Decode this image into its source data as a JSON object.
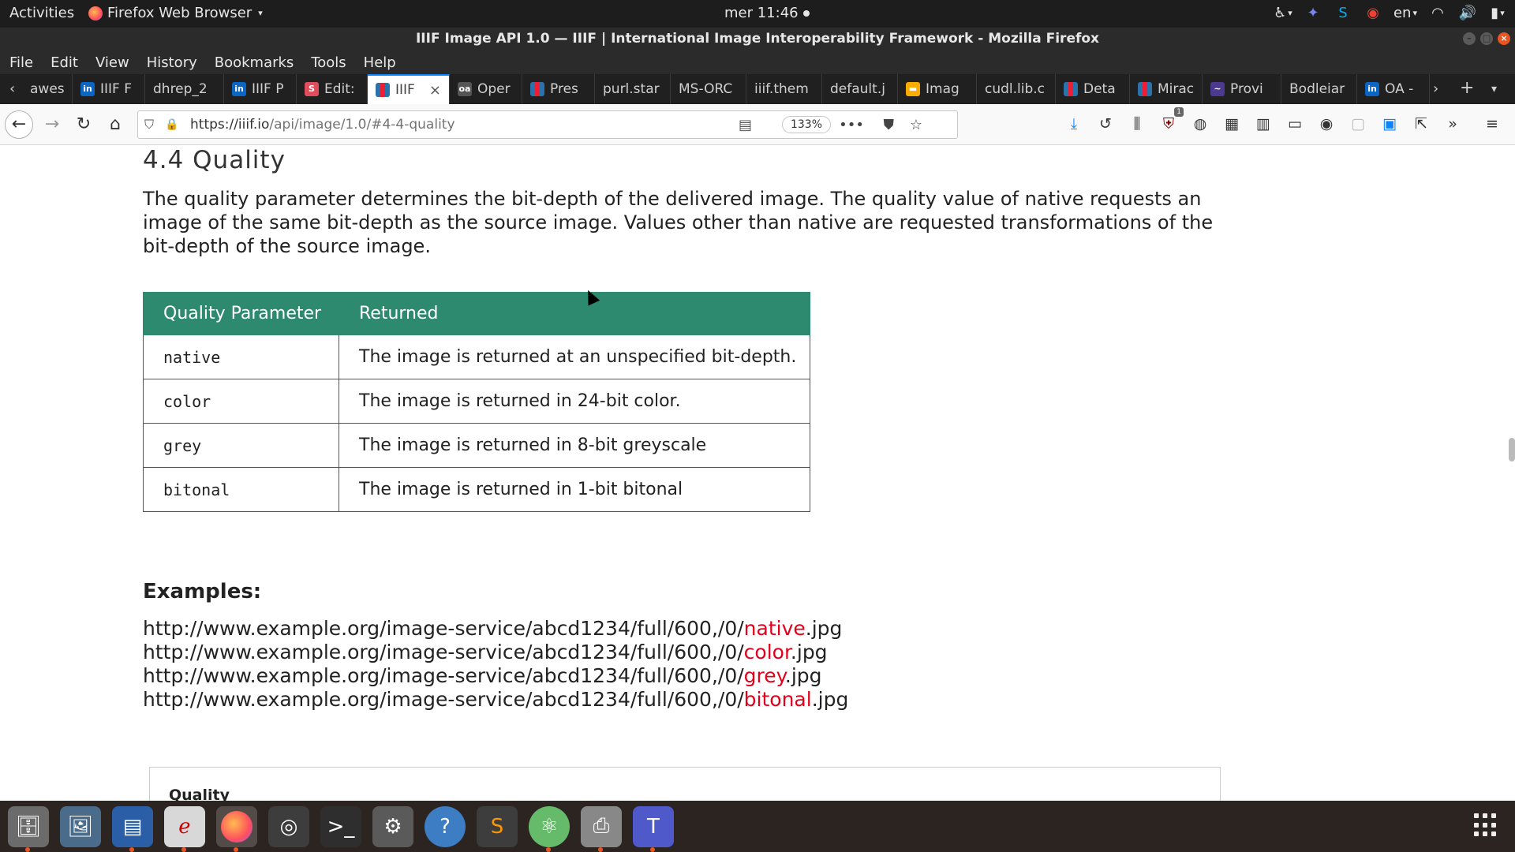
{
  "topbar": {
    "activities": "Activities",
    "app_name": "Firefox Web Browser",
    "clock": "mer 11:46",
    "language": "en"
  },
  "window": {
    "title": "IIIF Image API 1.0 — IIIF | International Image Interoperability Framework - Mozilla Firefox"
  },
  "menubar": [
    "File",
    "Edit",
    "View",
    "History",
    "Bookmarks",
    "Tools",
    "Help"
  ],
  "tabs": [
    {
      "label": "awes",
      "fav": ""
    },
    {
      "label": "IIIF F",
      "fav": "in"
    },
    {
      "label": "dhrep_2",
      "fav": ""
    },
    {
      "label": "IIIF P",
      "fav": "in"
    },
    {
      "label": "Edit:",
      "fav": "S"
    },
    {
      "label": "IIIF",
      "fav": "iiif",
      "active": true
    },
    {
      "label": "Oper",
      "fav": "oa"
    },
    {
      "label": "Pres",
      "fav": "iiif"
    },
    {
      "label": "purl.star",
      "fav": ""
    },
    {
      "label": "MS-ORC",
      "fav": ""
    },
    {
      "label": "iiif.them",
      "fav": ""
    },
    {
      "label": "default.j",
      "fav": ""
    },
    {
      "label": "Imag",
      "fav": "img"
    },
    {
      "label": "cudl.lib.c",
      "fav": ""
    },
    {
      "label": "Deta",
      "fav": "iiif"
    },
    {
      "label": "Mirac",
      "fav": "iiif"
    },
    {
      "label": "Provi",
      "fav": "pv"
    },
    {
      "label": "Bodleiar",
      "fav": ""
    },
    {
      "label": "OA -",
      "fav": "in"
    }
  ],
  "navbar": {
    "url_host": "https://iiif.io",
    "url_path": "/api/image/1.0/#4-4-quality",
    "zoom": "133%",
    "download_badge": "1"
  },
  "page": {
    "heading": "4.4 Quality",
    "paragraph": "The quality parameter determines the bit-depth of the delivered image. The quality value of native requests an image of the same bit-depth as the source image. Values other than native are requested transformations of the bit-depth of the source image.",
    "table": {
      "headers": [
        "Quality Parameter",
        "Returned"
      ],
      "rows": [
        [
          "native",
          "The image is returned at an unspecified bit-depth."
        ],
        [
          "color",
          "The image is returned in 24-bit color."
        ],
        [
          "grey",
          "The image is returned in 8-bit greyscale"
        ],
        [
          "bitonal",
          "The image is returned in 1-bit bitonal"
        ]
      ]
    },
    "examples_heading": "Examples:",
    "examples": [
      {
        "prefix": "http://www.example.org/image-service/abcd1234/full/600,/0/",
        "quality": "native",
        "suffix": ".jpg"
      },
      {
        "prefix": "http://www.example.org/image-service/abcd1234/full/600,/0/",
        "quality": "color",
        "suffix": ".jpg"
      },
      {
        "prefix": "http://www.example.org/image-service/abcd1234/full/600,/0/",
        "quality": "grey",
        "suffix": ".jpg"
      },
      {
        "prefix": "http://www.example.org/image-service/abcd1234/full/600,/0/",
        "quality": "bitonal",
        "suffix": ".jpg"
      }
    ],
    "box_title": "Quality"
  },
  "colors": {
    "table_header": "#2e8a6e",
    "quality_highlight": "#e3001b",
    "ubuntu_orange": "#e95420"
  }
}
